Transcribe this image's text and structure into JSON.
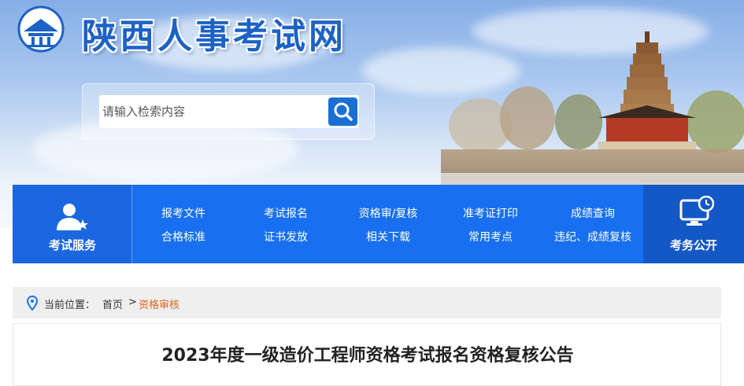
{
  "site": {
    "title": "陕西人事考试网",
    "logo_icon": "building-emblem-icon"
  },
  "search": {
    "placeholder": "请输入检索内容",
    "button_icon": "search-icon"
  },
  "nav": {
    "service": {
      "label": "考试服务",
      "icon": "person-star-icon"
    },
    "links": [
      [
        "报考文件",
        "合格标准"
      ],
      [
        "考试报名",
        "证书发放"
      ],
      [
        "资格审/复核",
        "相关下载"
      ],
      [
        "准考证打印",
        "常用考点"
      ],
      [
        "成绩查询",
        "违纪、成绩复核"
      ]
    ],
    "public": {
      "label": "考务公开",
      "icon": "monitor-clock-icon"
    }
  },
  "breadcrumb": {
    "prefix": "当前位置：",
    "home": "首页",
    "separator": ">",
    "current": "资格审核"
  },
  "article": {
    "title": "2023年度一级造价工程师资格考试报名资格复核公告"
  },
  "colors": {
    "brand_blue": "#1870f0",
    "title_blue": "#1d62c4",
    "accent_orange": "#e0651c"
  }
}
